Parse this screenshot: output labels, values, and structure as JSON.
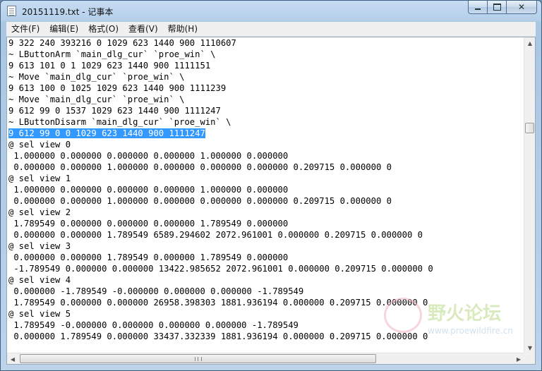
{
  "window": {
    "title": "20151119.txt - 记事本"
  },
  "caption": {
    "minimize_glyph": "",
    "maximize_glyph": "",
    "close_glyph": "✕"
  },
  "menu": [
    {
      "label": "文件(F)"
    },
    {
      "label": "编辑(E)"
    },
    {
      "label": "格式(O)"
    },
    {
      "label": "查看(V)"
    },
    {
      "label": "帮助(H)"
    }
  ],
  "document": {
    "lines": [
      "9 322 240 393216 0 1029 623 1440 900 1110607",
      "~ LButtonArm `main_dlg_cur` `proe_win` \\",
      "9 613 101 0 1 1029 623 1440 900 1111151",
      "~ Move `main_dlg_cur` `proe_win` \\",
      "9 613 100 0 1025 1029 623 1440 900 1111239",
      "~ Move `main_dlg_cur` `proe_win` \\",
      "9 612 99 0 1537 1029 623 1440 900 1111247",
      "~ LButtonDisarm `main_dlg_cur` `proe_win` \\",
      "9 612 99 0 0 1029 623 1440 900 1111247",
      "@ sel view 0",
      " 1.000000 0.000000 0.000000 0.000000 1.000000 0.000000",
      " 0.000000 0.000000 1.000000 0.000000 0.000000 0.000000 0.209715 0.000000 0",
      "@ sel view 1",
      " 1.000000 0.000000 0.000000 0.000000 1.000000 0.000000",
      " 0.000000 0.000000 1.000000 0.000000 0.000000 0.000000 0.209715 0.000000 0",
      "@ sel view 2",
      " 1.789549 0.000000 0.000000 0.000000 1.789549 0.000000",
      " 0.000000 0.000000 1.789549 6589.294602 2072.961001 0.000000 0.209715 0.000000 0",
      "@ sel view 3",
      " 0.000000 0.000000 1.789549 0.000000 1.789549 0.000000",
      " -1.789549 0.000000 0.000000 13422.985652 2072.961001 0.000000 0.209715 0.000000 0",
      "@ sel view 4",
      " 0.000000 -1.789549 -0.000000 0.000000 0.000000 -1.789549",
      " 1.789549 0.000000 0.000000 26958.398303 1881.936194 0.000000 0.209715 0.000000 0",
      "@ sel view 5",
      " 1.789549 -0.000000 0.000000 0.000000 0.000000 -1.789549",
      " 0.000000 1.789549 0.000000 33437.332339 1881.936194 0.000000 0.209715 0.000000 0"
    ],
    "selected_line_index": 8
  },
  "scrollbars": {
    "up_glyph": "▲",
    "down_glyph": "▼",
    "left_glyph": "◀",
    "right_glyph": "▶"
  },
  "watermark": {
    "text": "野火论坛",
    "url": "www.proewildfire.cn"
  }
}
